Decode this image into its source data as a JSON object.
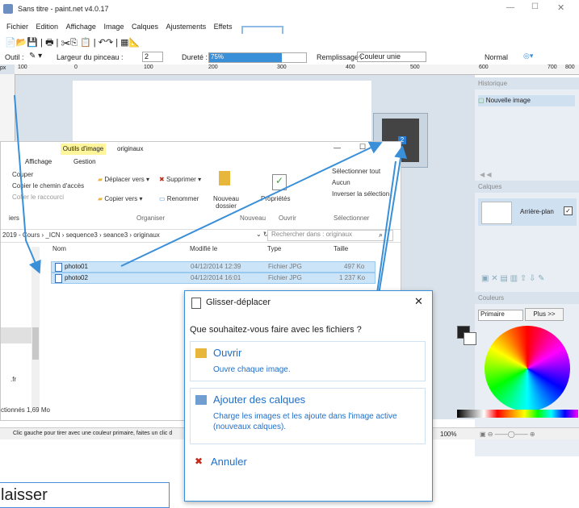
{
  "app": {
    "title": "Sans titre - paint.net v4.0.17",
    "menu": [
      "Fichier",
      "Edition",
      "Affichage",
      "Image",
      "Calques",
      "Ajustements",
      "Effets"
    ],
    "toolbar": {
      "outil_label": "Outil :",
      "brush_label": "Largeur du pinceau :",
      "brush_value": "2",
      "hardness_label": "Dureté :",
      "hardness_value": "75%",
      "hardness_fraction": 0.75,
      "fill_label": "Remplissage :",
      "fill_value": "Couleur unie",
      "blend_value": "Normal"
    },
    "ruler": {
      "unit": "px",
      "ticks": [
        "100",
        "0",
        "100",
        "200",
        "300",
        "400",
        "500",
        "600",
        "700",
        "800"
      ]
    },
    "status": "Clic gauche pour tirer avec une couleur primaire, faites un clic d",
    "zoom": "100%"
  },
  "panels": {
    "history_title": "Historique",
    "history_item": "Nouvelle image",
    "layers_title": "Calques",
    "layer_item": "Arrière-plan",
    "colors_title": "Couleurs",
    "primary_label": "Primaire",
    "more_button": "Plus >>"
  },
  "thumbnail_badge": "2",
  "explorer": {
    "tab_tools": "Outils d'image",
    "folder": "originaux",
    "tabs": [
      "Affichage",
      "Gestion"
    ],
    "ribbon": {
      "couper": "Couper",
      "copier_chemin": "Copier le chemin d'accès",
      "coller_raccourci": "Coller le raccourci",
      "deplacer": "Déplacer vers",
      "supprimer": "Supprimer",
      "copier_vers": "Copier vers",
      "renommer": "Renommer",
      "nouveau_dossier": "Nouveau dossier",
      "proprietes": "Propriétés",
      "selectionner_tout": "Sélectionner tout",
      "aucun": "Aucun",
      "inverser": "Inverser la sélection",
      "group_organiser": "Organiser",
      "group_nouveau": "Nouveau",
      "group_ouvrir": "Ouvrir",
      "group_selectionner": "Sélectionner",
      "group_left": "iers"
    },
    "breadcrumb": "2019 - Cours  ›  _ICN  ›  sequence3  ›  seance3  ›  originaux",
    "search_placeholder": "Rechercher dans : originaux",
    "columns": [
      "Nom",
      "Modifié le",
      "Type",
      "Taille"
    ],
    "files": [
      {
        "name": "photo01",
        "date": "04/12/2014 12:39",
        "type": "Fichier JPG",
        "size": "497 Ko"
      },
      {
        "name": "photo02",
        "date": "04/12/2014 16:01",
        "type": "Fichier JPG",
        "size": "1 237 Ko"
      }
    ],
    "sidebar_fr": ".fr",
    "footer": "ctionnés  1,69 Mo"
  },
  "dialog": {
    "title": "Glisser-déplacer",
    "question": "Que souhaitez-vous faire avec les fichiers ?",
    "open_title": "Ouvrir",
    "open_desc": "Ouvre chaque image.",
    "layers_title": "Ajouter des calques",
    "layers_desc": "Charge les images et les ajoute dans l'image active (nouveaux calques).",
    "cancel": "Annuler"
  },
  "note_text": "laisser",
  "colors": {
    "accent": "#3a8fd9",
    "selection": "#cce4f7",
    "link": "#1f6fc9",
    "cancel": "#c42b1c"
  }
}
